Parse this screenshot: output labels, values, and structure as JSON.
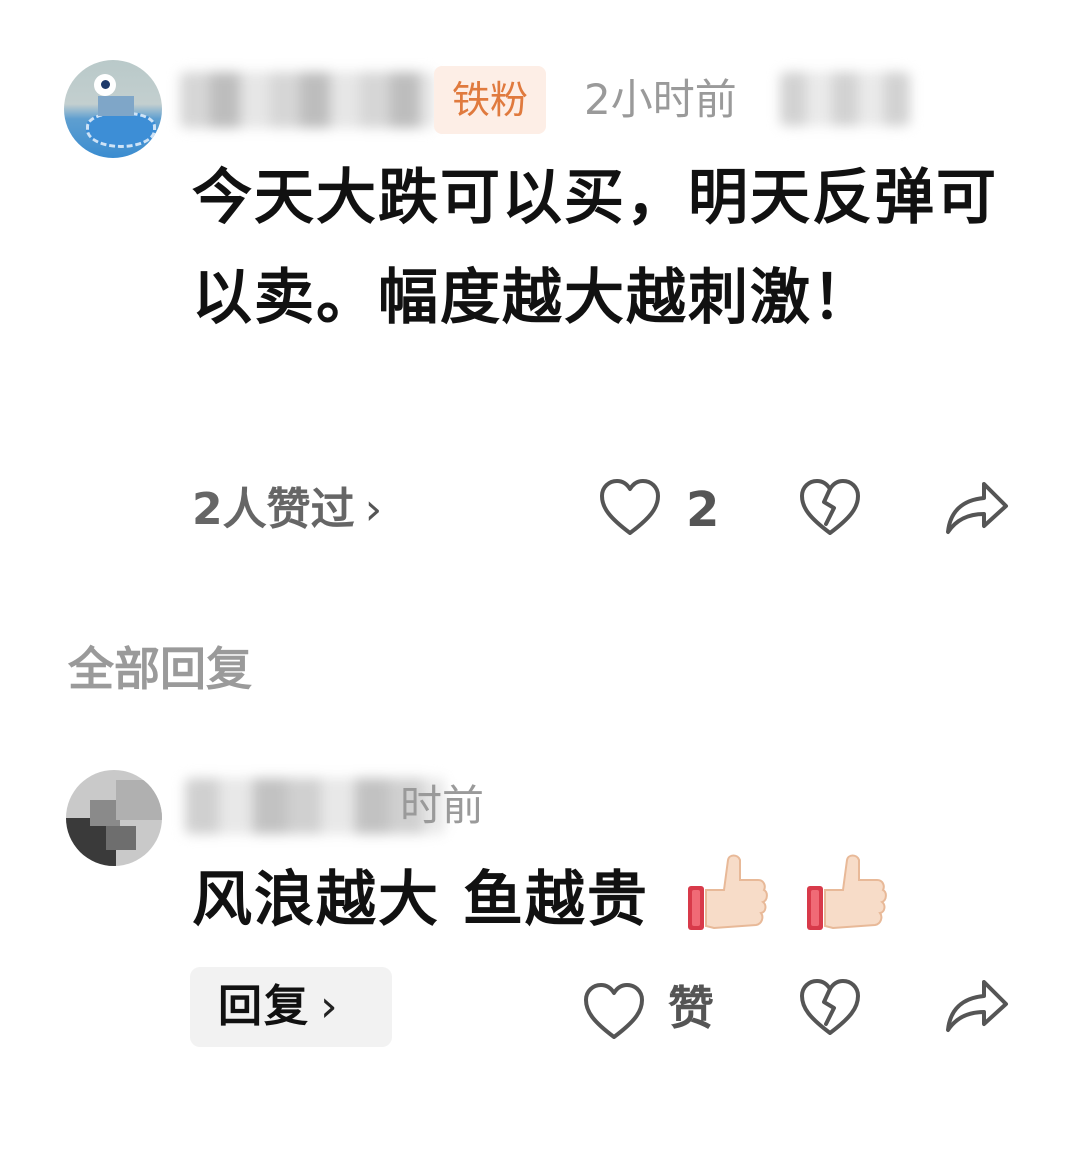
{
  "comment1": {
    "badge": "铁粉",
    "time": "2小时前",
    "text": "今天大跌可以买，明天反弹可以卖。幅度越大越刺激！",
    "likes_summary": "2人赞过",
    "likes_chevron": "›",
    "like_count": "2",
    "icons": [
      "heart-outline-icon",
      "broken-heart-icon",
      "share-arrow-icon"
    ]
  },
  "section": {
    "title": "全部回复"
  },
  "comment2": {
    "time": "时前",
    "text": "风浪越大 鱼越贵",
    "emojis": [
      "thumbs-up-icon",
      "thumbs-up-icon"
    ],
    "reply_label": "回复",
    "reply_chevron": "›",
    "like_label": "赞",
    "icons": [
      "heart-outline-icon",
      "broken-heart-icon",
      "share-arrow-icon"
    ]
  },
  "colors": {
    "badge_bg": "#fdeee6",
    "badge_text": "#e07a3e",
    "muted_text": "#9a9a9a",
    "icon_gray": "#555555"
  }
}
